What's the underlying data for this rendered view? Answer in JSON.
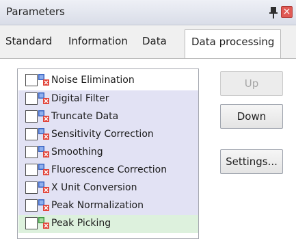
{
  "window": {
    "title": "Parameters"
  },
  "tabs": [
    {
      "label": "Standard"
    },
    {
      "label": "Information"
    },
    {
      "label": "Data"
    },
    {
      "label": "Data processing"
    }
  ],
  "active_tab": "Data processing",
  "processing_list": {
    "items": [
      {
        "label": "Noise Elimination",
        "checked": false,
        "icon": "processing-step-icon",
        "highlight": "none"
      },
      {
        "label": "Digital Filter",
        "checked": false,
        "icon": "processing-step-icon",
        "highlight": "purple"
      },
      {
        "label": "Truncate Data",
        "checked": false,
        "icon": "processing-step-icon",
        "highlight": "purple"
      },
      {
        "label": "Sensitivity Correction",
        "checked": false,
        "icon": "processing-step-icon",
        "highlight": "purple"
      },
      {
        "label": "Smoothing",
        "checked": false,
        "icon": "processing-step-icon",
        "highlight": "purple"
      },
      {
        "label": "Fluorescence Correction",
        "checked": false,
        "icon": "processing-step-icon",
        "highlight": "purple"
      },
      {
        "label": "X Unit Conversion",
        "checked": false,
        "icon": "processing-step-icon",
        "highlight": "purple"
      },
      {
        "label": "Peak Normalization",
        "checked": false,
        "icon": "processing-step-icon",
        "highlight": "purple"
      },
      {
        "label": "Peak Picking",
        "checked": false,
        "icon": "processing-step-green-icon",
        "highlight": "green"
      }
    ]
  },
  "buttons": {
    "up": {
      "label": "Up",
      "enabled": false
    },
    "down": {
      "label": "Down",
      "enabled": true
    },
    "settings": {
      "label": "Settings...",
      "enabled": true
    }
  },
  "colors": {
    "row_purple": "#e2e2f4",
    "row_green": "#ddf1dd",
    "close_button": "#e05a55"
  }
}
